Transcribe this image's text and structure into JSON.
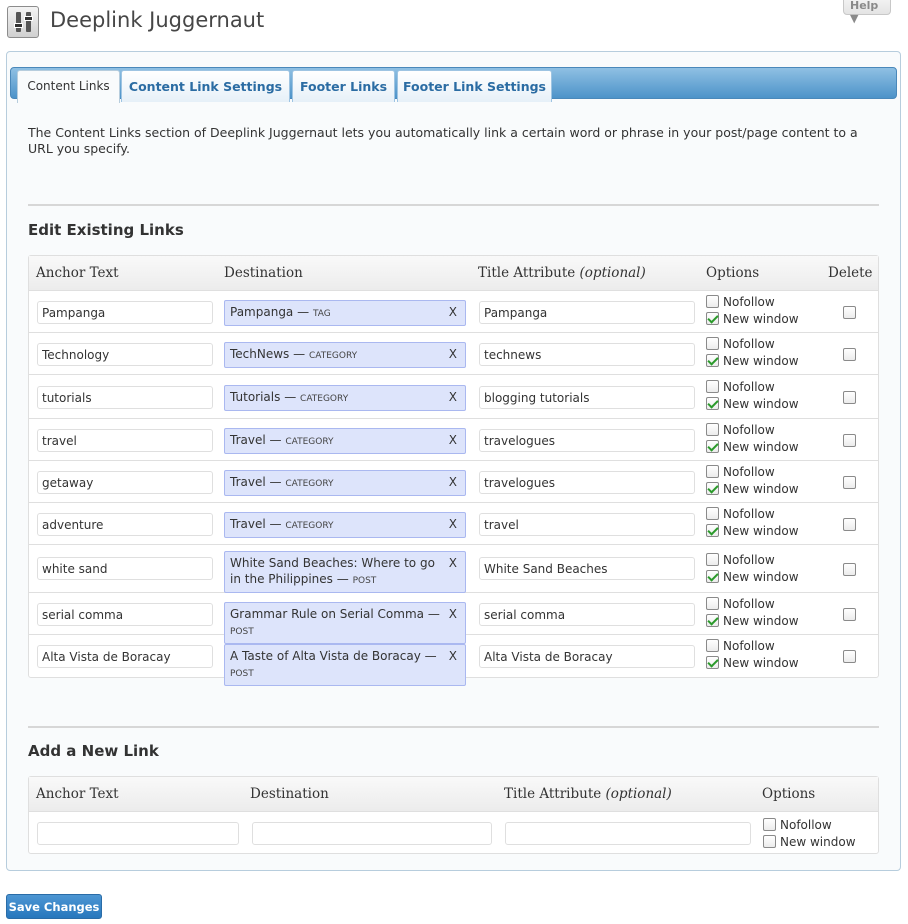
{
  "page": {
    "title": "Deeplink Juggernaut",
    "help_label": "Help ▼"
  },
  "tabs": [
    {
      "label": "Content Links",
      "active": true
    },
    {
      "label": "Content Link Settings",
      "active": false
    },
    {
      "label": "Footer Links",
      "active": false
    },
    {
      "label": "Footer Link Settings",
      "active": false
    }
  ],
  "intro": "The Content Links section of Deeplink Juggernaut lets you automatically link a certain word or phrase in your post/page content to a URL you specify.",
  "edit_section": {
    "title": "Edit Existing Links",
    "headers": {
      "anchor": "Anchor Text",
      "destination": "Destination",
      "title_attr": "Title Attribute",
      "title_attr_note": "(optional)",
      "options": "Options",
      "delete": "Delete"
    },
    "rows": [
      {
        "anchor": "Pampanga",
        "dest_name": "Pampanga",
        "dest_type": "Tag",
        "title": "Pampanga",
        "nofollow": false,
        "new_window": true,
        "delete": false
      },
      {
        "anchor": "Technology",
        "dest_name": "TechNews",
        "dest_type": "Category",
        "title": "technews",
        "nofollow": false,
        "new_window": true,
        "delete": false
      },
      {
        "anchor": "tutorials",
        "dest_name": "Tutorials",
        "dest_type": "Category",
        "title": "blogging tutorials",
        "nofollow": false,
        "new_window": true,
        "delete": false
      },
      {
        "anchor": "travel",
        "dest_name": "Travel",
        "dest_type": "Category",
        "title": "travelogues",
        "nofollow": false,
        "new_window": true,
        "delete": false
      },
      {
        "anchor": "getaway",
        "dest_name": "Travel",
        "dest_type": "Category",
        "title": "travelogues",
        "nofollow": false,
        "new_window": true,
        "delete": false
      },
      {
        "anchor": "adventure",
        "dest_name": "Travel",
        "dest_type": "Category",
        "title": "travel",
        "nofollow": false,
        "new_window": true,
        "delete": false
      },
      {
        "anchor": "white sand",
        "dest_name": "White Sand Beaches: Where to go in the Philippines",
        "dest_type": "Post",
        "title": "White Sand Beaches",
        "nofollow": false,
        "new_window": true,
        "delete": false
      },
      {
        "anchor": "serial comma",
        "dest_name": "Grammar Rule on Serial Comma",
        "dest_type": "Post",
        "title": "serial comma",
        "nofollow": false,
        "new_window": true,
        "delete": false
      },
      {
        "anchor": "Alta Vista de Boracay",
        "dest_name": "A Taste of Alta Vista de Boracay",
        "dest_type": "Post",
        "title": "Alta Vista de Boracay",
        "nofollow": false,
        "new_window": true,
        "delete": false
      }
    ],
    "option_labels": {
      "nofollow": "Nofollow",
      "new_window": "New window"
    },
    "remove_glyph": "X",
    "dash": "—"
  },
  "add_section": {
    "title": "Add a New Link",
    "headers": {
      "anchor": "Anchor Text",
      "destination": "Destination",
      "title_attr": "Title Attribute",
      "title_attr_note": "(optional)",
      "options": "Options"
    },
    "values": {
      "anchor": "",
      "destination": "",
      "title": ""
    },
    "nofollow": false,
    "new_window": false
  },
  "save_label": "Save Changes",
  "colors": {
    "tab_bar": "#4d93c9",
    "tab_text": "#2b6ca3",
    "dest_bg": "#dde4fb",
    "save_btn": "#2777bd"
  }
}
